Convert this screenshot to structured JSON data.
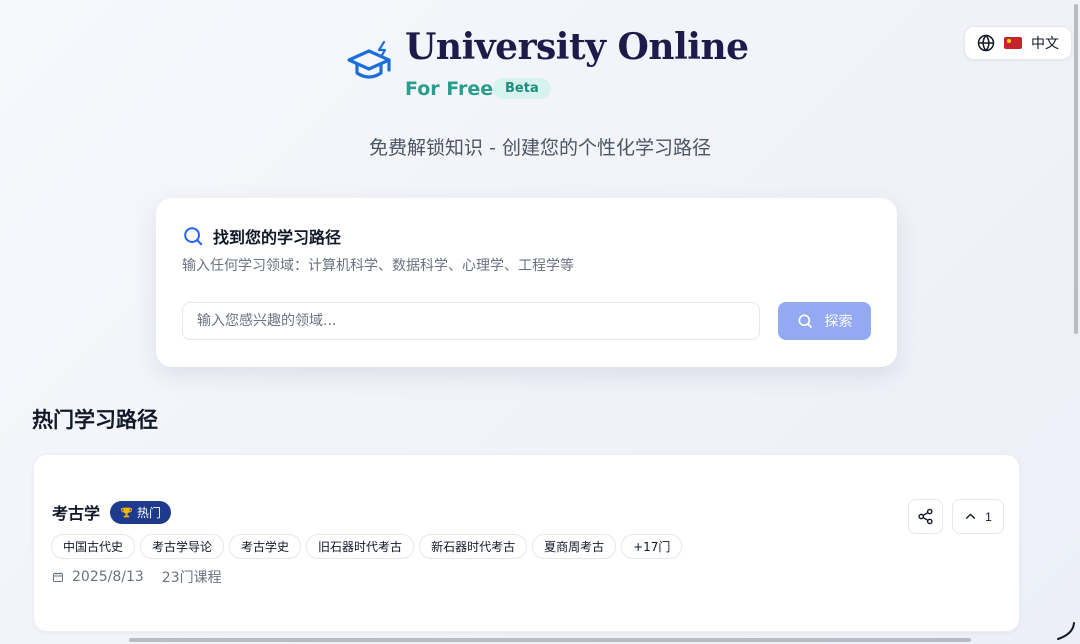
{
  "language": {
    "flag_icon": "china-flag-icon",
    "label": "中文"
  },
  "brand": {
    "title": "University Online",
    "subtitle": "For Free",
    "badge": "Beta"
  },
  "tagline": "免费解锁知识 - 创建您的个性化学习路径",
  "search": {
    "title": "找到您的学习路径",
    "description": "输入任何学习领域：计算机科学、数据科学、心理学、工程学等",
    "placeholder": "输入您感兴趣的领域...",
    "button_label": "探索"
  },
  "section": {
    "title": "热门学习路径"
  },
  "paths": [
    {
      "name": "考古学",
      "badge": "热门",
      "tags": [
        "中国古代史",
        "考古学导论",
        "考古学史",
        "旧石器时代考古",
        "新石器时代考古",
        "夏商周考古",
        "+17门"
      ],
      "date": "2025/8/13",
      "course_count": "23门课程",
      "upvotes": "1"
    }
  ],
  "colors": {
    "accent": "#2a9d8f",
    "primary": "#1e3a8a",
    "button": "#93a9f2"
  }
}
